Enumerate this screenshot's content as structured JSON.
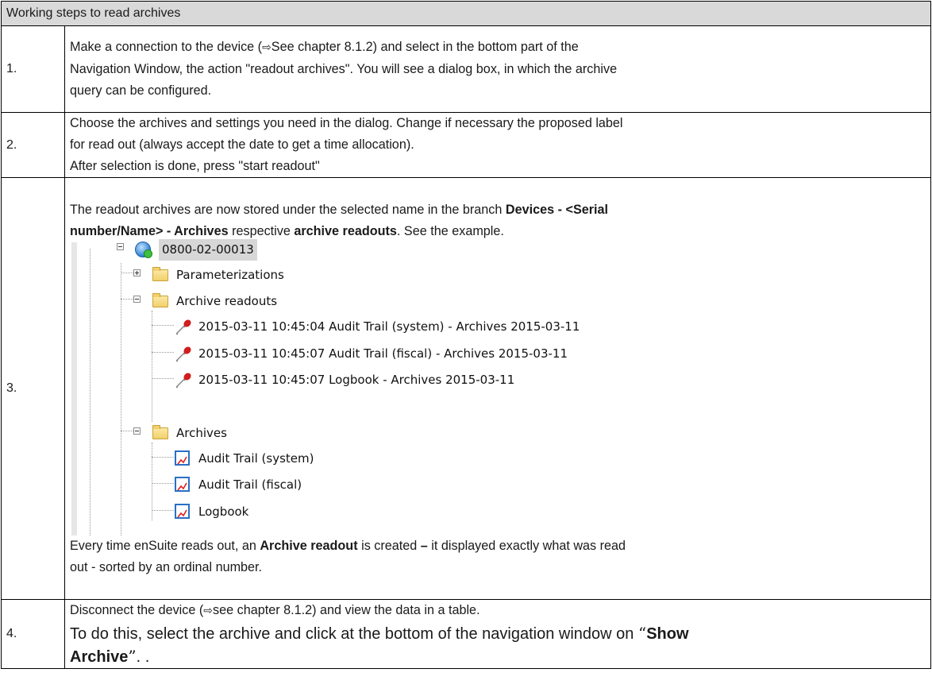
{
  "header": "Working steps to read archives",
  "steps": [
    {
      "num": "1.",
      "lines": [
        "Make a connection to the device (",
        "See chapter 8.1.2) and select in the bottom part of the",
        "Navigation Window, the action \"readout archives\". You will see a dialog box, in which the archive",
        "query can be configured."
      ]
    },
    {
      "num": "2.",
      "lines": [
        "Choose the archives and settings you need in the dialog. Change if necessary the proposed label",
        "for read out (always accept the date to get a time allocation).",
        "After selection is done, press \"start readout\""
      ]
    },
    {
      "num": "3.",
      "intro": {
        "t1": "The readout archives are now stored under the selected name in the branch ",
        "b1": "Devices - <Serial",
        "b2": "number/Name> - Archives",
        "t2": " respective ",
        "b3": "archive readouts",
        "t3": ". See the example."
      },
      "tree": {
        "device": "0800-02-00013",
        "parameterizations": "Parameterizations",
        "archive_readouts": "Archive readouts",
        "readouts": [
          "2015-03-11 10:45:04 Audit Trail (system) - Archives 2015-03-11",
          "2015-03-11 10:45:07 Audit Trail (fiscal) - Archives 2015-03-11",
          "2015-03-11 10:45:07 Logbook - Archives 2015-03-11"
        ],
        "archives": "Archives",
        "archive_items": [
          "Audit Trail (system)",
          "Audit Trail (fiscal)",
          "Logbook"
        ]
      },
      "outro": {
        "t1": "Every time enSuite reads out, an ",
        "b1": "Archive readout",
        "t2": " is created ",
        "dash": "–",
        "t3": " it displayed exactly what was read",
        "t4": "out - sorted by an ordinal number."
      }
    },
    {
      "num": "4.",
      "line1a": "Disconnect the device (",
      "line1b": "see chapter 8.1.2) and view the data in a table.",
      "line2": "To do this, select the archive and click at the bottom of the navigation window on ",
      "q_open": "“",
      "bold1": "Show",
      "bold2": "Archive",
      "q_close": "”",
      "tail": ". ."
    }
  ],
  "arrow_glyph": "⇨"
}
